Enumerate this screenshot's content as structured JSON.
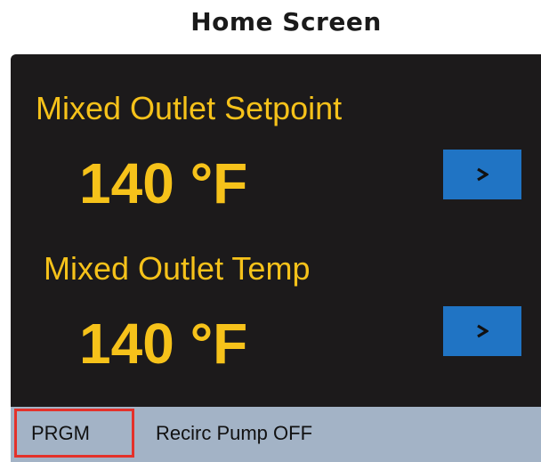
{
  "page_title": "Home Screen",
  "colors": {
    "screen_background": "#1c1a1b",
    "text_accent": "#f6c21a",
    "button_blue": "#2074c4",
    "status_bar": "#a3b3c6",
    "highlight_border": "#e4312a"
  },
  "setpoint": {
    "label": "Mixed Outlet Setpoint",
    "value": "140 °F",
    "button_icon": "chevron-right-icon"
  },
  "outlet_temp": {
    "label": "Mixed Outlet Temp",
    "value": "140 °F",
    "button_icon": "chevron-right-icon"
  },
  "status_bar": {
    "prgm_label": "PRGM",
    "status_text": "Recirc Pump OFF"
  }
}
